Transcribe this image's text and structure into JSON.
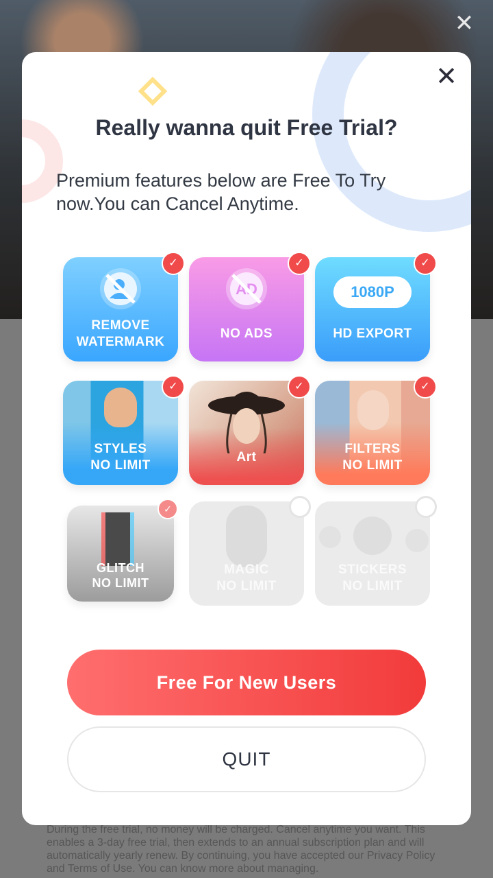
{
  "outer_close_icon": "close-icon",
  "modal": {
    "close_icon": "close-icon",
    "title": "Really wanna quit Free Trial?",
    "subtitle": "Premium features below are Free To Try now.You can Cancel Anytime."
  },
  "features": [
    {
      "label": "REMOVE WATERMARK",
      "checked": true,
      "icon": "no-watermark-icon"
    },
    {
      "label": "NO ADS",
      "checked": true,
      "icon": "no-ad-icon",
      "icon_text": "AD"
    },
    {
      "label": "HD EXPORT",
      "checked": true,
      "icon": "hd-1080p-icon",
      "icon_text": "1080P"
    },
    {
      "label": "STYLES NO LIMIT",
      "checked": true,
      "icon": "styles-photo"
    },
    {
      "label": "Art",
      "checked": true,
      "icon": "art-photo"
    },
    {
      "label": "FILTERS NO LIMIT",
      "checked": true,
      "icon": "filters-photo"
    },
    {
      "label": "GLITCH NO LIMIT",
      "checked": true,
      "icon": "glitch-photo"
    },
    {
      "label": "MAGIC NO LIMIT",
      "checked": false,
      "icon": "magic-photo"
    },
    {
      "label": "STICKERS NO LIMIT",
      "checked": false,
      "icon": "stickers-emoji"
    }
  ],
  "buttons": {
    "primary": "Free For New Users",
    "quit": "QUIT"
  },
  "footer": "During the free trial, no money will be charged. Cancel anytime you want. This enables a 3-day free trial, then extends to an annual subscription plan and will automatically yearly renew. By continuing, you have accepted our Privacy Policy and Terms of Use. You can know more about managing."
}
